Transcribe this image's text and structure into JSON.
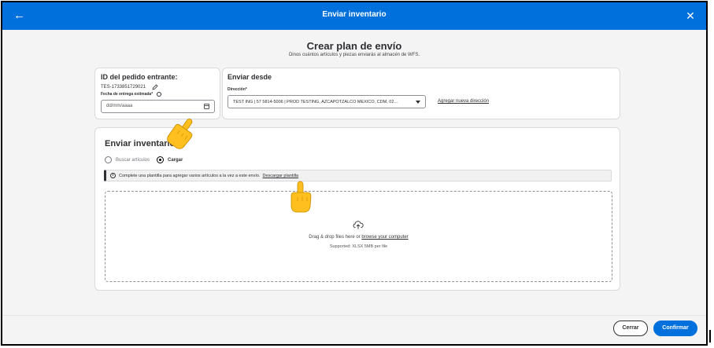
{
  "header": {
    "title": "Enviar inventario",
    "back_icon": "arrow-left-icon",
    "close_icon": "close-icon"
  },
  "page": {
    "heading": "Crear plan de envío",
    "subheading": "Dinos cuántos artículos y piezas enviarás al almacén de WFS."
  },
  "order": {
    "title": "ID del pedido entrante:",
    "id": "TES-1733851729021",
    "date_label": "Fecha de entrega estimada*",
    "date_placeholder": "dd/mm/aaaa"
  },
  "ship_from": {
    "title": "Enviar desde",
    "address_label": "Dirección*",
    "address_value": "TEST ING | 57 5814-5006 | PROD TESTING, AZCAPOTZALCO MEXICO, CDM, 02...",
    "add_address_link": "Agregar nueva dirección"
  },
  "inventory": {
    "title": "Enviar inventario",
    "options": [
      "Buscar artículos",
      "Cargar"
    ],
    "selected_option": "Cargar",
    "info_message": "Complete una plantilla para agregar varios artículos a la vez a este envío.",
    "download_link": "Descargar plantilla",
    "drop_text_prefix": "Drag & drop files here or ",
    "drop_link": "browse your computer",
    "drop_supported": "Supported: XLSX 5MB per file"
  },
  "footer": {
    "cancel_label": "Cerrar",
    "confirm_label": "Confirmar"
  },
  "colors": {
    "brand_blue": "#0071dc",
    "pointer_yellow": "#ffbf1f"
  }
}
